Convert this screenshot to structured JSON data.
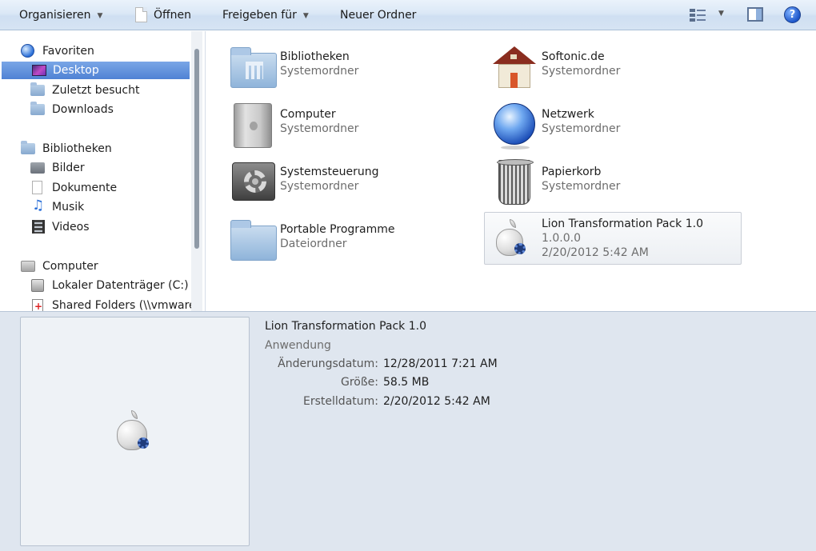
{
  "toolbar": {
    "organize": "Organisieren",
    "open": "Öffnen",
    "share": "Freigeben für",
    "new_folder": "Neuer Ordner"
  },
  "sidebar": {
    "favorites": {
      "label": "Favoriten",
      "items": [
        "Desktop",
        "Zuletzt besucht",
        "Downloads"
      ]
    },
    "libraries": {
      "label": "Bibliotheken",
      "items": [
        "Bilder",
        "Dokumente",
        "Musik",
        "Videos"
      ]
    },
    "computer": {
      "label": "Computer",
      "items": [
        "Lokaler Datenträger (C:)",
        "Shared Folders (\\\\vmware-"
      ]
    },
    "selected": "Desktop"
  },
  "files": [
    {
      "name": "Bibliotheken",
      "sub": "Systemordner"
    },
    {
      "name": "Softonic.de",
      "sub": "Systemordner"
    },
    {
      "name": "Computer",
      "sub": "Systemordner"
    },
    {
      "name": "Netzwerk",
      "sub": "Systemordner"
    },
    {
      "name": "Systemsteuerung",
      "sub": "Systemordner"
    },
    {
      "name": "Papierkorb",
      "sub": "Systemordner"
    },
    {
      "name": "Portable Programme",
      "sub": "Dateiordner"
    },
    {
      "name": "Lion Transformation Pack 1.0",
      "sub": "1.0.0.0",
      "sub2": "2/20/2012 5:42 AM"
    }
  ],
  "details": {
    "title": "Lion Transformation Pack 1.0",
    "type": "Anwendung",
    "modified_label": "Änderungsdatum:",
    "modified_value": "12/28/2011 7:21 AM",
    "size_label": "Größe:",
    "size_value": "58.5 MB",
    "created_label": "Erstelldatum:",
    "created_value": "2/20/2012 5:42 AM"
  }
}
